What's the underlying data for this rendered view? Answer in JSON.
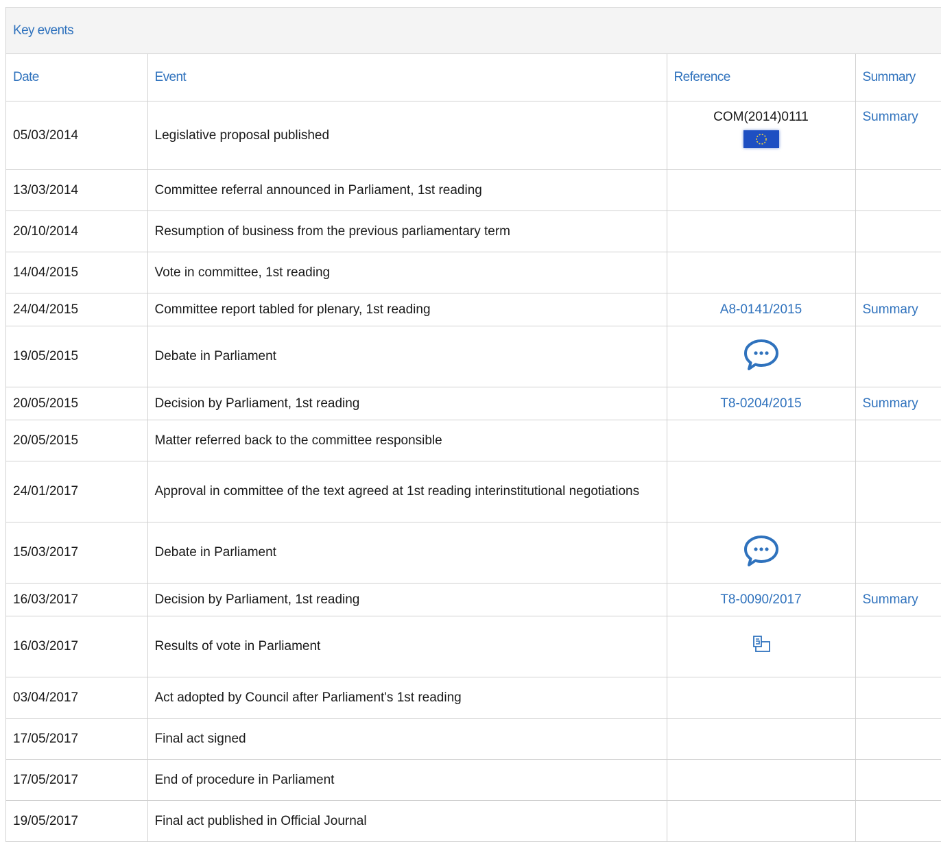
{
  "panel": {
    "title": "Key events"
  },
  "columns": {
    "date": "Date",
    "event": "Event",
    "reference": "Reference",
    "summary": "Summary"
  },
  "colors": {
    "link": "#2f72bd",
    "border": "#d0d0d0",
    "header_bg": "#f4f4f4",
    "flag": "#1e4fc2"
  },
  "icons": {
    "flag": "eu-flag-icon",
    "debate": "debate-speech-bubble-icon",
    "vote": "vote-results-icon"
  },
  "rows": [
    {
      "date": "05/03/2014",
      "event": "Legislative proposal published",
      "reference": "COM(2014)0111",
      "summary": "Summary"
    },
    {
      "date": "13/03/2014",
      "event": "Committee referral announced in Parliament, 1st reading"
    },
    {
      "date": "20/10/2014",
      "event": "Resumption of business from the previous parliamentary term"
    },
    {
      "date": "14/04/2015",
      "event": "Vote in committee, 1st reading"
    },
    {
      "date": "24/04/2015",
      "event": "Committee report tabled for plenary, 1st reading",
      "reference": "A8-0141/2015",
      "summary": "Summary"
    },
    {
      "date": "19/05/2015",
      "event": "Debate in Parliament"
    },
    {
      "date": "20/05/2015",
      "event": "Decision by Parliament, 1st reading",
      "reference": "T8-0204/2015",
      "summary": "Summary"
    },
    {
      "date": "20/05/2015",
      "event": "Matter referred back to the committee responsible"
    },
    {
      "date": "24/01/2017",
      "event": "Approval in committee of the text agreed at 1st reading interinstitutional negotiations"
    },
    {
      "date": "15/03/2017",
      "event": "Debate in Parliament"
    },
    {
      "date": "16/03/2017",
      "event": "Decision by Parliament, 1st reading",
      "reference": "T8-0090/2017",
      "summary": "Summary"
    },
    {
      "date": "16/03/2017",
      "event": "Results of vote in Parliament"
    },
    {
      "date": "03/04/2017",
      "event": "Act adopted by Council after Parliament's 1st reading"
    },
    {
      "date": "17/05/2017",
      "event": "Final act signed"
    },
    {
      "date": "17/05/2017",
      "event": "End of procedure in Parliament"
    },
    {
      "date": "19/05/2017",
      "event": "Final act published in Official Journal"
    }
  ]
}
